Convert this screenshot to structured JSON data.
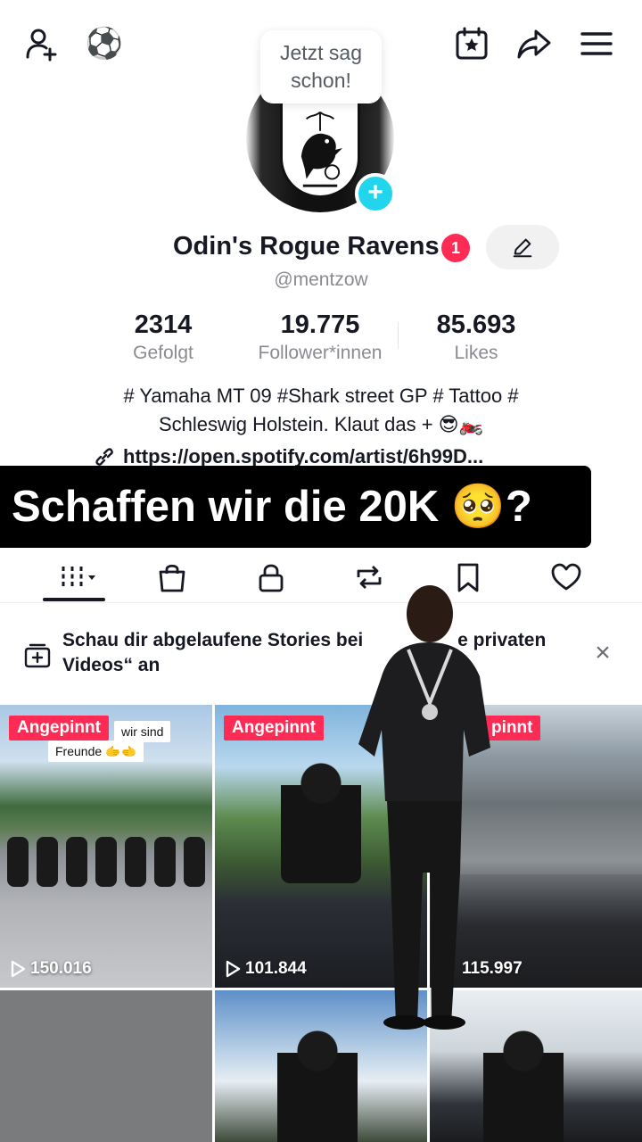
{
  "header": {
    "add_friend_icon": "person-plus-icon",
    "soccer_emoji": "⚽",
    "bubble_text_line1": "Jetzt sag",
    "bubble_text_line2": "schon!",
    "calendar_icon": "calendar-star-icon",
    "share_icon": "share-arrow-icon",
    "menu_icon": "hamburger-menu-icon"
  },
  "profile": {
    "name": "Odin's Rogue Ravens",
    "notification_count": "1",
    "handle": "@mentzow",
    "accent_color": "#fe2c55",
    "add_color": "#20d5ec"
  },
  "stats": [
    {
      "value": "2314",
      "label": "Gefolgt"
    },
    {
      "value": "19.775",
      "label": "Follower*innen"
    },
    {
      "value": "85.693",
      "label": "Likes"
    }
  ],
  "bio": {
    "line1": "# Yamaha MT 09 #Shark street GP # Tattoo #",
    "line2": "Schleswig Holstein. Klaut das + 😎🏍️",
    "link": "https://open.spotify.com/artist/6h99D..."
  },
  "caption_overlay": "Schaffen wir die 20K 🥺?",
  "tabs": [
    {
      "icon": "grid-videos-icon",
      "active": true
    },
    {
      "icon": "shopping-bag-icon",
      "active": false
    },
    {
      "icon": "lock-icon",
      "active": false
    },
    {
      "icon": "repost-icon",
      "active": false
    },
    {
      "icon": "bookmark-icon",
      "active": false
    },
    {
      "icon": "heart-icon",
      "active": false
    }
  ],
  "stories_banner": {
    "line1": "Schau dir abgelaufene Stories bei",
    "line1_tail": "e privaten",
    "line2": "Videos“ an"
  },
  "videos": [
    {
      "pinned_label": "Angepinnt",
      "note_line1": "wir sind",
      "note_line2": "Freunde 🫱🫲",
      "views": "150.016"
    },
    {
      "pinned_label": "Angepinnt",
      "views": "101.844"
    },
    {
      "pinned_label": "pinnt",
      "views": "115.997"
    },
    {},
    {},
    {}
  ]
}
